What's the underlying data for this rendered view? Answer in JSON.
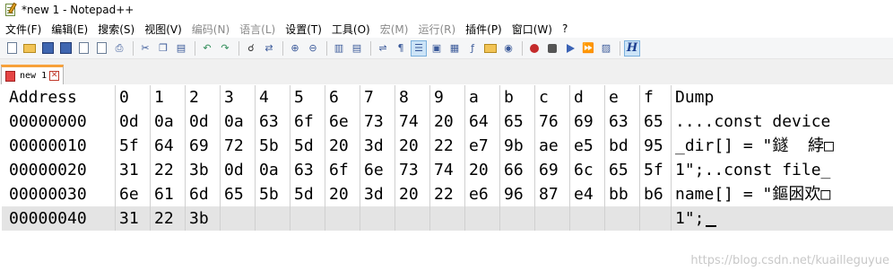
{
  "window": {
    "title": "*new 1 - Notepad++"
  },
  "menu": [
    {
      "label": "文件(F)",
      "enabled": true
    },
    {
      "label": "编辑(E)",
      "enabled": true
    },
    {
      "label": "搜索(S)",
      "enabled": true
    },
    {
      "label": "视图(V)",
      "enabled": true
    },
    {
      "label": "编码(N)",
      "enabled": false
    },
    {
      "label": "语言(L)",
      "enabled": false
    },
    {
      "label": "设置(T)",
      "enabled": true
    },
    {
      "label": "工具(O)",
      "enabled": true
    },
    {
      "label": "宏(M)",
      "enabled": false
    },
    {
      "label": "运行(R)",
      "enabled": false
    },
    {
      "label": "插件(P)",
      "enabled": true
    },
    {
      "label": "窗口(W)",
      "enabled": true
    },
    {
      "label": "?",
      "enabled": true
    }
  ],
  "toolbar": {
    "hex_button_label": "H"
  },
  "tab": {
    "label": "new 1",
    "close_glyph": "✕"
  },
  "hex_view": {
    "header": [
      "Address",
      "0",
      "1",
      "2",
      "3",
      "4",
      "5",
      "6",
      "7",
      "8",
      "9",
      "a",
      "b",
      "c",
      "d",
      "e",
      "f",
      "Dump"
    ],
    "rows": [
      {
        "address": "00000000",
        "bytes": [
          "0d",
          "0a",
          "0d",
          "0a",
          "63",
          "6f",
          "6e",
          "73",
          "74",
          "20",
          "64",
          "65",
          "76",
          "69",
          "63",
          "65"
        ],
        "dump": "....const device"
      },
      {
        "address": "00000010",
        "bytes": [
          "5f",
          "64",
          "69",
          "72",
          "5b",
          "5d",
          "20",
          "3d",
          "20",
          "22",
          "e7",
          "9b",
          "ae",
          "e5",
          "bd",
          "95"
        ],
        "dump": "_dir[] = \"鐩  綍□"
      },
      {
        "address": "00000020",
        "bytes": [
          "31",
          "22",
          "3b",
          "0d",
          "0a",
          "63",
          "6f",
          "6e",
          "73",
          "74",
          "20",
          "66",
          "69",
          "6c",
          "65",
          "5f"
        ],
        "dump": "1\";..const file_"
      },
      {
        "address": "00000030",
        "bytes": [
          "6e",
          "61",
          "6d",
          "65",
          "5b",
          "5d",
          "20",
          "3d",
          "20",
          "22",
          "e6",
          "96",
          "87",
          "e4",
          "bb",
          "b6"
        ],
        "dump": "name[] = \"鏂囦欢□"
      },
      {
        "address": "00000040",
        "bytes": [
          "31",
          "22",
          "3b",
          "",
          "",
          "",
          "",
          "",
          "",
          "",
          "",
          "",
          "",
          "",
          "",
          ""
        ],
        "dump": "1\";"
      }
    ],
    "current_row_index": 4
  },
  "watermark": "https://blog.csdn.net/kuailleguyue"
}
